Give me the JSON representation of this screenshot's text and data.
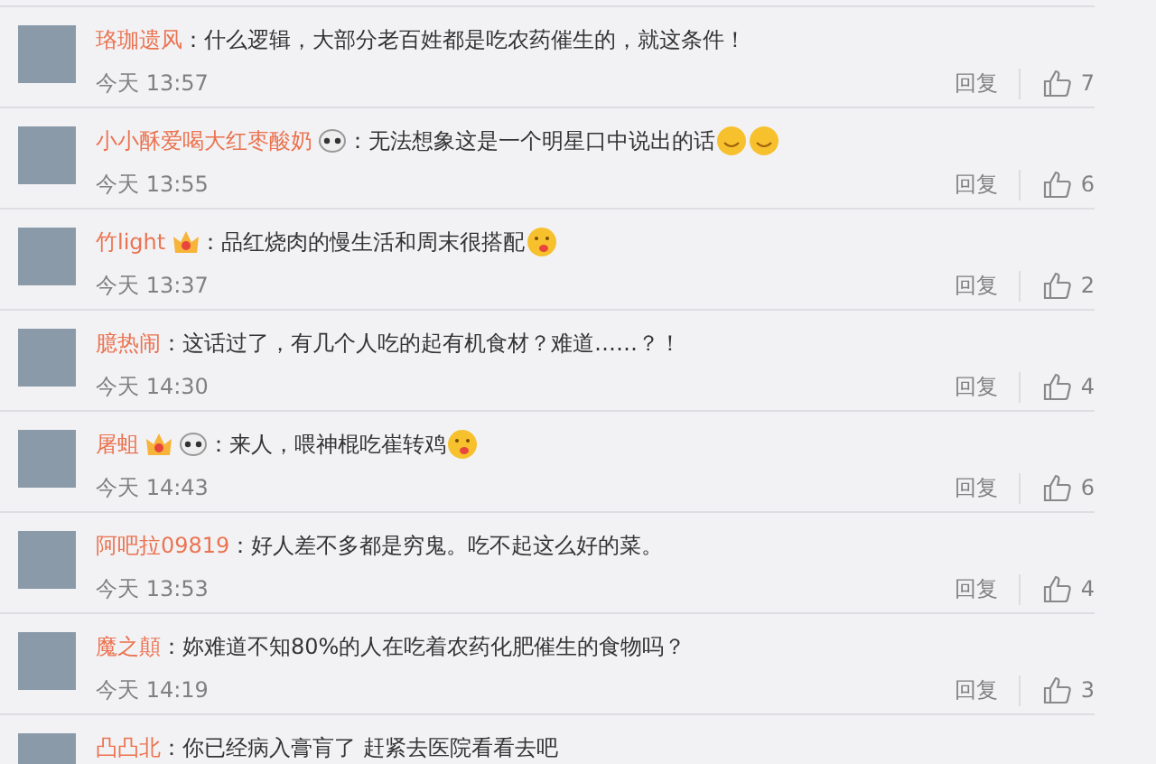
{
  "comments": [
    {
      "name": "珞珈遗风",
      "text": "：什么逻辑，大部分老百姓都是吃农药催生的，就这条件！",
      "time": "今天 13:57",
      "reply": "回复",
      "likes": "7"
    },
    {
      "name": "小小酥爱喝大红枣酸奶",
      "badges": [
        {
          "kind": "panda"
        }
      ],
      "text": "：无法想象这是一个明星口中说出的话",
      "emojis": [
        {
          "kind": "smile"
        },
        {
          "kind": "smile"
        }
      ],
      "time": "今天 13:55",
      "reply": "回复",
      "likes": "6"
    },
    {
      "name": "竹light",
      "badges": [
        {
          "kind": "crown"
        }
      ],
      "text": "：品红烧肉的慢生活和周末很搭配",
      "emojis": [
        {
          "kind": "tongue"
        }
      ],
      "time": "今天 13:37",
      "reply": "回复",
      "likes": "2"
    },
    {
      "name": "臆热闹",
      "text": "：这话过了，有几个人吃的起有机食材？难道……？！",
      "time": "今天 14:30",
      "reply": "回复",
      "likes": "4"
    },
    {
      "name": "屠蛆",
      "badges": [
        {
          "kind": "crown"
        },
        {
          "kind": "panda"
        }
      ],
      "text": "：来人，喂神棍吃崔转鸡",
      "emojis": [
        {
          "kind": "tongue"
        }
      ],
      "time": "今天 14:43",
      "reply": "回复",
      "likes": "6"
    },
    {
      "name": "阿吧拉09819",
      "text": "：好人差不多都是穷鬼。吃不起这么好的菜。",
      "time": "今天 13:53",
      "reply": "回复",
      "likes": "4"
    },
    {
      "name": "魔之顛",
      "text": "：妳难道不知80%的人在吃着农药化肥催生的食物吗？",
      "time": "今天 14:19",
      "reply": "回复",
      "likes": "3"
    },
    {
      "name": "凸凸北",
      "text": "：你已经病入膏肓了 赶紧去医院看看去吧"
    }
  ]
}
